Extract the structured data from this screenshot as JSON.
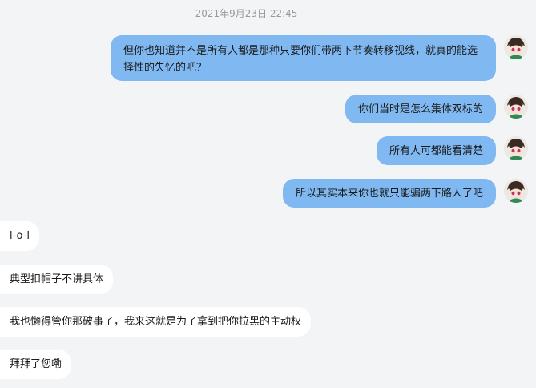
{
  "chat": {
    "timestamp": "2021年9月23日 22:45",
    "messages": [
      {
        "direction": "out",
        "text": "但你也知道并不是所有人都是那种只要你们带两下节奏转移视线，就真的能选择性的失忆的吧？"
      },
      {
        "direction": "out",
        "text": "你们当时是怎么集体双标的"
      },
      {
        "direction": "out",
        "text": "所有人可都能看清楚"
      },
      {
        "direction": "out",
        "text": "所以其实本来你也就只能骗两下路人了吧"
      },
      {
        "direction": "in",
        "text": "l-o-l"
      },
      {
        "direction": "in",
        "text": "典型扣帽子不讲具体"
      },
      {
        "direction": "in",
        "text": "我也懒得管你那破事了，我来这就是为了拿到把你拉黑的主动权"
      },
      {
        "direction": "in",
        "text": "拜拜了您嘞"
      }
    ]
  },
  "colors": {
    "background": "#f3f4f6",
    "outgoing_bubble": "#80b9f2",
    "incoming_bubble": "#ffffff",
    "timestamp_text": "#9a9a9a"
  },
  "avatar_icon": "anime-character-avatar-icon"
}
